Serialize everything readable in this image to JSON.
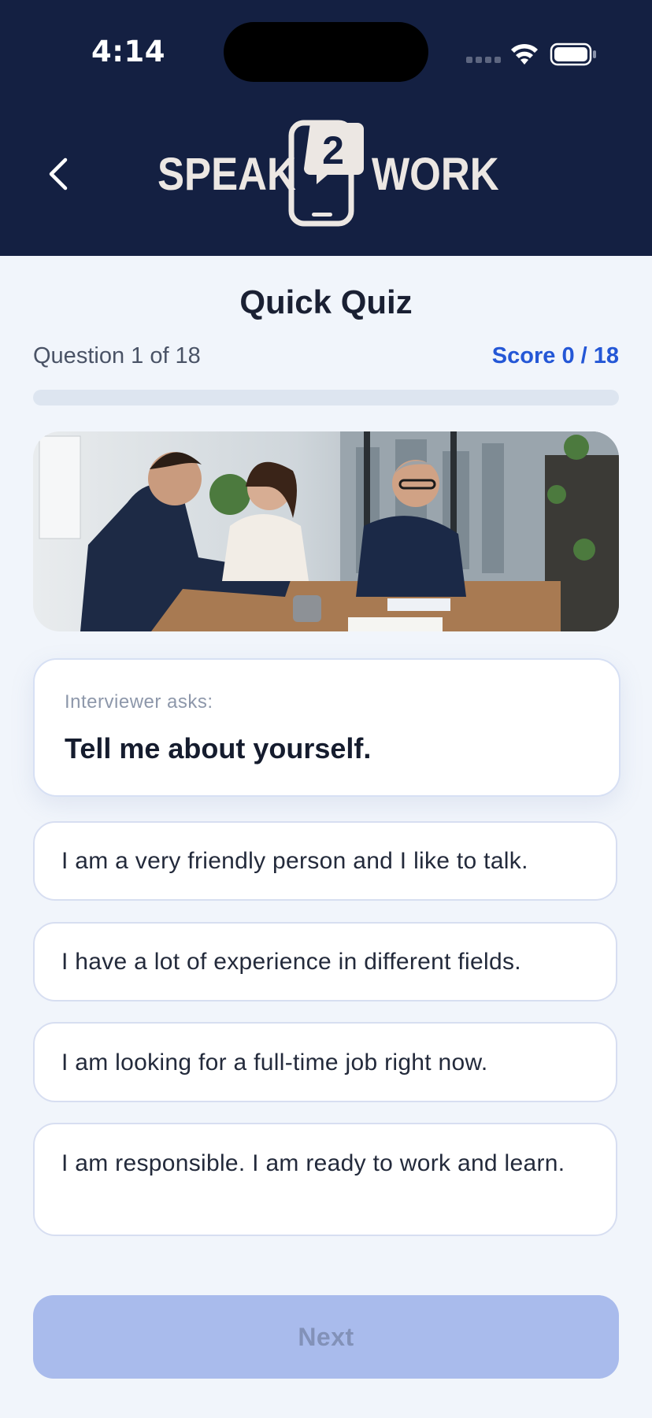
{
  "status_bar": {
    "time": "4:14"
  },
  "header": {
    "logo_left": "SPEAK",
    "logo_number": "2",
    "logo_right": "WORK"
  },
  "quiz": {
    "title": "Quick Quiz",
    "question_counter": "Question 1 of 18",
    "score": "Score 0 / 18",
    "progress_fraction": 0
  },
  "prompt": {
    "label": "Interviewer asks:",
    "text": "Tell me about yourself."
  },
  "options": [
    {
      "label": "I am a very friendly person and I like to talk."
    },
    {
      "label": "I have a lot of experience in different fields."
    },
    {
      "label": "I am looking for a full-time job right now."
    },
    {
      "label": "I am responsible. I am ready to work and learn."
    }
  ],
  "footer": {
    "next_label": "Next"
  },
  "colors": {
    "header_bg": "#142042",
    "accent": "#2457d6",
    "next_disabled": "#a9bbec"
  }
}
